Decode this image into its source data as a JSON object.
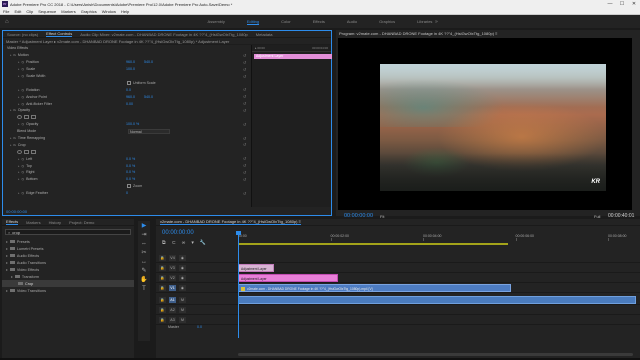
{
  "titlebar": {
    "app_icon": "Pr",
    "title": "Adobe Premiere Pro CC 2018 - C:\\Users\\Anish\\Documents\\Adobe\\Premiere Pro\\12.0\\Adobe Premiere Pro Auto-Save\\Demo *",
    "minimize": "—",
    "maximize": "☐",
    "close": "✕"
  },
  "menu": [
    "File",
    "Edit",
    "Clip",
    "Sequence",
    "Markers",
    "Graphics",
    "Window",
    "Help"
  ],
  "workspaces": {
    "items": [
      "Assembly",
      "Editing",
      "Color",
      "Effects",
      "Audio",
      "Graphics",
      "Libraries"
    ],
    "active": "Editing",
    "more": "»"
  },
  "effect_controls": {
    "tabs": [
      "Source: (no clips)",
      "Effect Controls",
      "Audio Clip Mixer: v2mate.com - DHANBAD DRONE Footage in 4K ??\"4_(HsiGwOlxTtg_1080p",
      "Metadata"
    ],
    "active_tab": "Effect Controls",
    "subheader": "Master * Adjustment Layer  ▸  v2mate.com - DHANBAD DRONE Footage in 4K ??\"4_(HsiGwOlxTtg_1080p) * Adjustment Layer",
    "ruler_start": "▸ 00:00",
    "ruler_end": "00:00:04:00",
    "clip_label": "Adjustment Layer",
    "rows": [
      {
        "type": "section",
        "label": "Video Effects"
      },
      {
        "type": "effect",
        "label": "Motion"
      },
      {
        "type": "param",
        "label": "Position",
        "v1": "960.0",
        "v2": "540.0"
      },
      {
        "type": "param",
        "label": "Scale",
        "v1": "100.0",
        "v2": ""
      },
      {
        "type": "param",
        "label": "Scale Width",
        "v1": "",
        "v2": ""
      },
      {
        "type": "check",
        "label": "",
        "check": "Uniform Scale"
      },
      {
        "type": "param",
        "label": "Rotation",
        "v1": "0.0",
        "v2": ""
      },
      {
        "type": "param",
        "label": "Anchor Point",
        "v1": "960.0",
        "v2": "540.0"
      },
      {
        "type": "param",
        "label": "Anti-flicker Filter",
        "v1": "0.00",
        "v2": ""
      },
      {
        "type": "effect",
        "label": "Opacity"
      },
      {
        "type": "icons",
        "label": ""
      },
      {
        "type": "param",
        "label": "Opacity",
        "v1": "100.0 %",
        "v2": ""
      },
      {
        "type": "select",
        "label": "Blend Mode",
        "sel": "Normal"
      },
      {
        "type": "effect",
        "label": "Time Remapping"
      },
      {
        "type": "effect",
        "label": "Crop"
      },
      {
        "type": "icons",
        "label": ""
      },
      {
        "type": "param",
        "label": "Left",
        "v1": "0.0 %",
        "v2": ""
      },
      {
        "type": "param",
        "label": "Top",
        "v1": "0.0 %",
        "v2": ""
      },
      {
        "type": "param",
        "label": "Right",
        "v1": "0.0 %",
        "v2": ""
      },
      {
        "type": "param",
        "label": "Bottom",
        "v1": "0.0 %",
        "v2": ""
      },
      {
        "type": "check",
        "label": "",
        "check": "Zoom"
      },
      {
        "type": "param",
        "label": "Edge Feather",
        "v1": "0",
        "v2": ""
      }
    ],
    "timecode": "00:00:00:00"
  },
  "program": {
    "title": "Program: v2mate.com - DHANBAD DRONE Footage in 4K ??\"4_(HsiGwOlxTtg_1080p)  ≡",
    "timecode": "00:00:00:00",
    "fit": "Fit",
    "full": "Full",
    "duration": "00:00:40:01",
    "watermark": "KR",
    "controls": [
      "▾",
      "{",
      "}",
      "|◀",
      "◀|",
      "▶",
      "|▶",
      "▶|",
      "⬚",
      "⬓",
      "📷",
      "+"
    ]
  },
  "effects_panel": {
    "tabs": [
      "Effects",
      "Markers",
      "History",
      "Project: Demo"
    ],
    "active_tab": "Effects",
    "search": "crop",
    "tree": [
      {
        "label": "Presets",
        "indent": 1,
        "selected": false
      },
      {
        "label": "Lumetri Presets",
        "indent": 1,
        "selected": false
      },
      {
        "label": "Audio Effects",
        "indent": 1,
        "selected": false
      },
      {
        "label": "Audio Transitions",
        "indent": 1,
        "selected": false
      },
      {
        "label": "Video Effects",
        "indent": 1,
        "selected": false
      },
      {
        "label": "Transform",
        "indent": 2,
        "selected": false
      },
      {
        "label": "Crop",
        "indent": 3,
        "selected": true
      },
      {
        "label": "Video Transitions",
        "indent": 1,
        "selected": false
      }
    ]
  },
  "tools": [
    "▶",
    "⇥",
    "⇔",
    "✂",
    "↔",
    "✎",
    "✋",
    "T"
  ],
  "timeline": {
    "tabs": [
      "v2mate.com - DHANBAD DRONE Footage in 4K ??\"4_(HsiGwOlxTtg_1080p)  ≡"
    ],
    "timecode": "00:00:00:00",
    "ruler": [
      "00:00",
      "00:00:02:00",
      "00:00:04:00",
      "00:00:06:00",
      "00:00:08:00"
    ],
    "tracks": [
      {
        "name": "V4",
        "clips": []
      },
      {
        "name": "V3",
        "clips": [
          {
            "label": "Adjustment Layer",
            "kind": "adjA",
            "start": 0,
            "end": 0.09
          }
        ]
      },
      {
        "name": "V2",
        "clips": [
          {
            "label": "Adjustment Layer",
            "kind": "adjB",
            "start": 0,
            "end": 0.25
          }
        ]
      },
      {
        "name": "V1",
        "clips": [
          {
            "label": "v2mate.com - DHANBAD DRONE Footage in 4K ??\"4_(HsiGwOlxTtg_1080p).mp4 [V]",
            "kind": "vid",
            "start": 0,
            "end": 0.685
          }
        ]
      },
      {
        "name": "A1",
        "clips": [
          {
            "label": "",
            "kind": "aud",
            "start": 0,
            "end": 1.0
          }
        ]
      },
      {
        "name": "A2",
        "clips": []
      },
      {
        "name": "A3",
        "clips": []
      }
    ],
    "master_label": "Master",
    "master_value": "0.0"
  }
}
